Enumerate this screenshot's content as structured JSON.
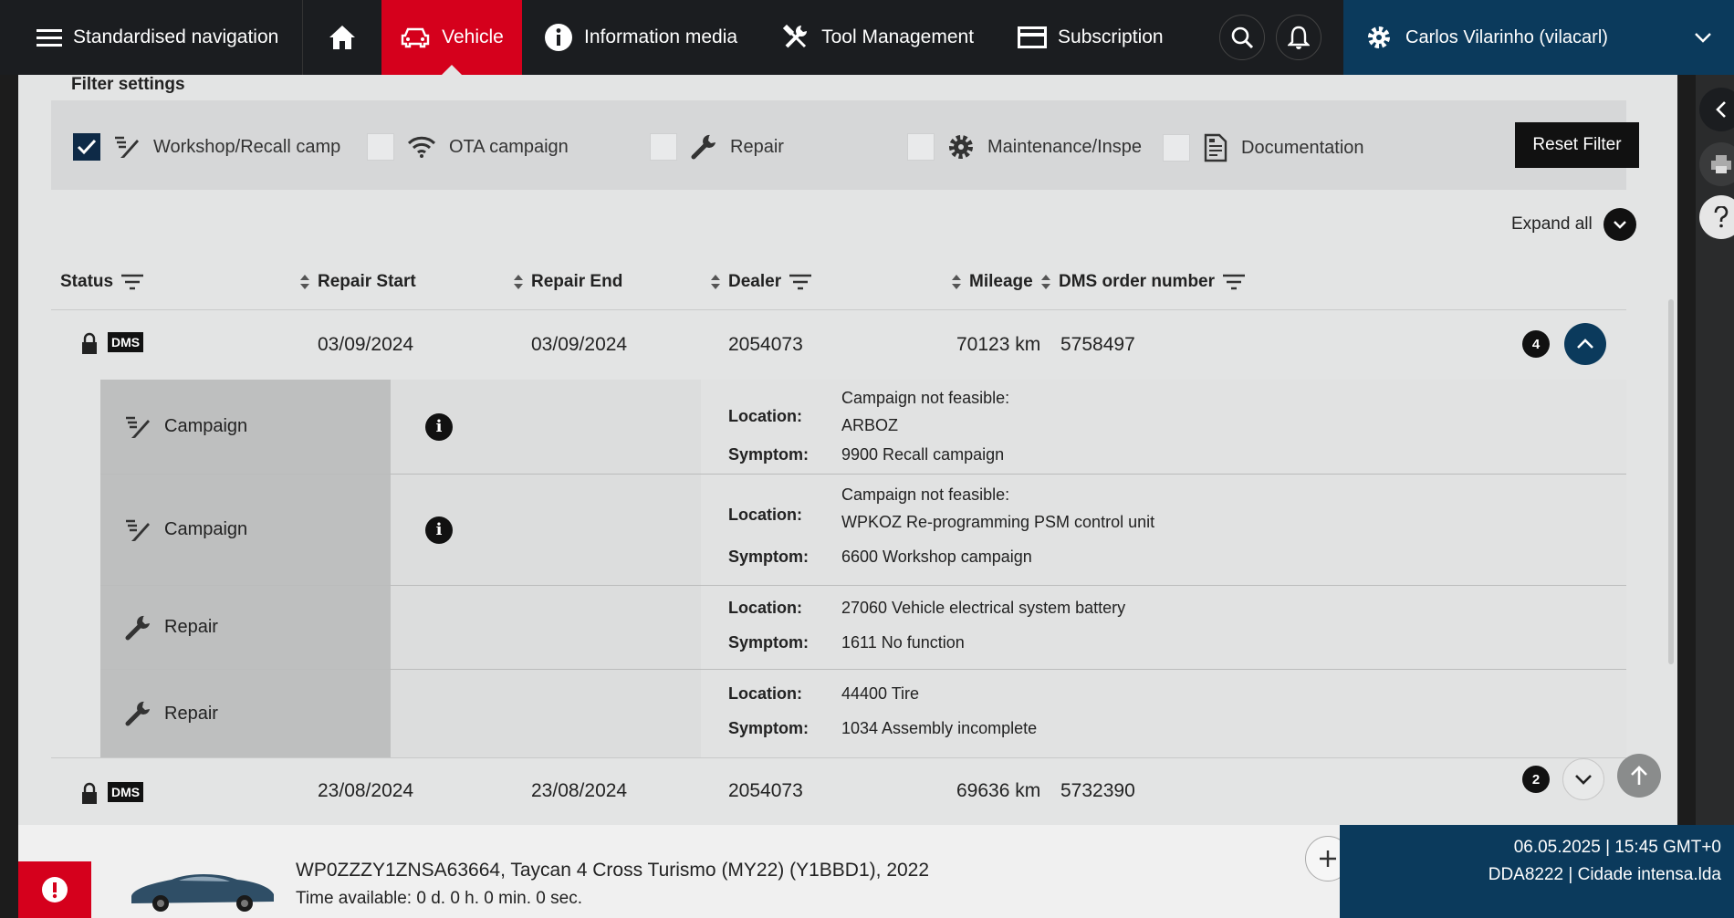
{
  "nav": {
    "menu_label": "Standardised navigation",
    "items": [
      {
        "label": "Vehicle"
      },
      {
        "label": "Information media"
      },
      {
        "label": "Tool Management"
      },
      {
        "label": "Subscription"
      }
    ],
    "user": "Carlos Vilarinho (vilacarl)",
    "active_color": "#d5001c"
  },
  "filters": {
    "title": "Filter settings",
    "items": [
      {
        "label": "Workshop/Recall camp",
        "checked": true
      },
      {
        "label": "OTA campaign",
        "checked": false
      },
      {
        "label": "Repair",
        "checked": false
      },
      {
        "label": "Maintenance/Inspe",
        "checked": false
      },
      {
        "label": "Documentation",
        "checked": false
      }
    ],
    "reset_label": "Reset Filter"
  },
  "expand_all_label": "Expand all",
  "table": {
    "headers": [
      "Status",
      "Repair Start",
      "Repair End",
      "Dealer",
      "Mileage",
      "DMS order number"
    ],
    "rows": [
      {
        "status": "DMS",
        "start": "03/09/2024",
        "end": "03/09/2024",
        "dealer": "2054073",
        "mileage": "70123 km",
        "order": "5758497",
        "count": "4"
      },
      {
        "status": "DMS",
        "start": "23/08/2024",
        "end": "23/08/2024",
        "dealer": "2054073",
        "mileage": "69636 km",
        "order": "5732390",
        "count": "2"
      }
    ],
    "details": [
      {
        "type": "Campaign",
        "location_label": "Location:",
        "symptom_label": "Symptom:",
        "location_1": "Campaign not feasible:",
        "location_2": "ARBOZ",
        "symptom": "9900 Recall campaign"
      },
      {
        "type": "Campaign",
        "location_label": "Location:",
        "symptom_label": "Symptom:",
        "location_1": "Campaign not feasible:",
        "location_2": "WPKOZ Re-programming PSM control unit",
        "symptom": "6600 Workshop campaign"
      },
      {
        "type": "Repair",
        "location_label": "Location:",
        "symptom_label": "Symptom:",
        "location_1": "27060 Vehicle electrical system battery",
        "symptom": "1611 No function"
      },
      {
        "type": "Repair",
        "location_label": "Location:",
        "symptom_label": "Symptom:",
        "location_1": "44400 Tire",
        "symptom": "1034 Assembly incomplete"
      }
    ]
  },
  "footer": {
    "vehicle": "WP0ZZZY1ZNSA63664, Taycan 4 Cross Turismo (MY22) (Y1BBD1), 2022",
    "time_available": "Time available: 0 d. 0 h. 0 min. 0 sec.",
    "datetime": "06.05.2025 | 15:45 GMT+0",
    "dealer": "DDA8222 | Cidade intensa.lda"
  }
}
